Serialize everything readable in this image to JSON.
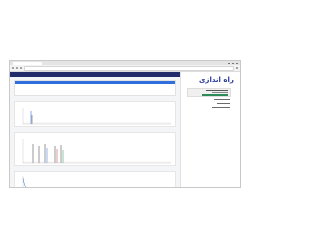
{
  "browser": {
    "tab_title": "",
    "url": ""
  },
  "app": {
    "header_title": "",
    "brand_color": "#232c6b",
    "accent_color": "#2f6fdd"
  },
  "section_tabs": [
    "",
    "",
    ""
  ],
  "charts": [
    {
      "title": "",
      "legend": [
        "",
        "",
        ""
      ]
    },
    {
      "title": "",
      "legend": [
        "",
        "",
        "",
        ""
      ]
    },
    {
      "title": ""
    }
  ],
  "sidebar": {
    "logo_text": "راه اندازی",
    "account_button_color": "#2e8b57",
    "menu_items_count_label": ""
  }
}
